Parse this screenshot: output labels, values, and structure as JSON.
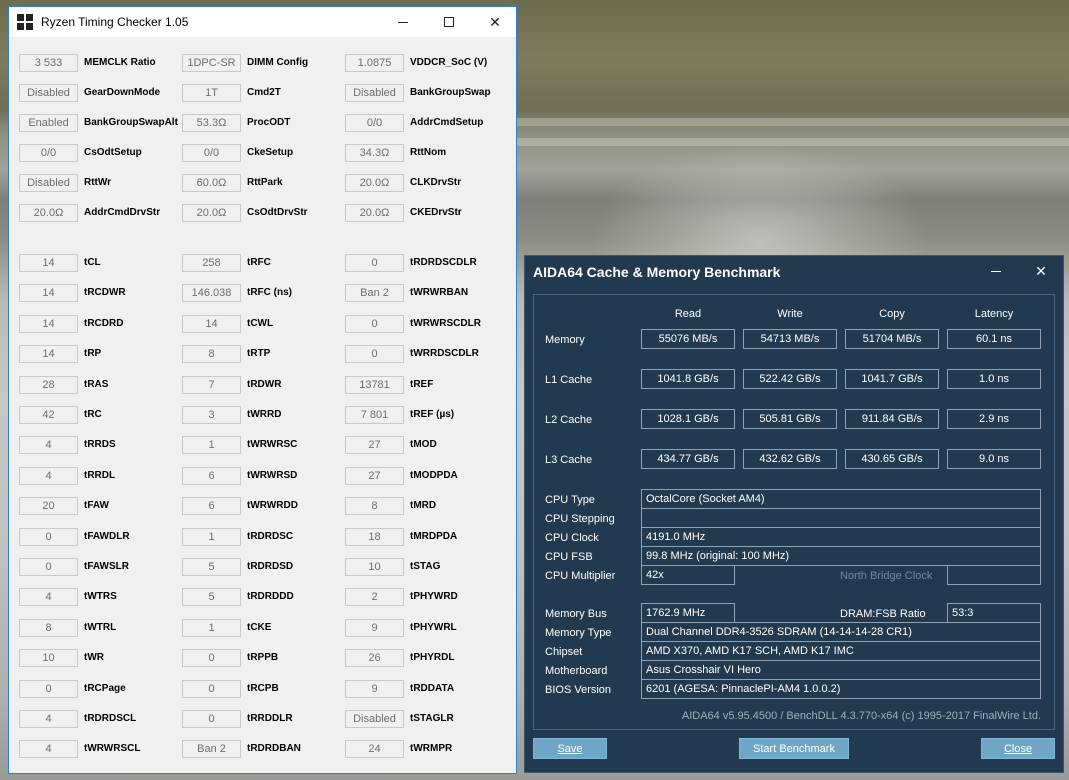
{
  "rtc": {
    "title": "Ryzen Timing Checker 1.05",
    "rows": [
      [
        {
          "v": "3 533",
          "l": "MEMCLK Ratio"
        },
        {
          "v": "1DPC-SR",
          "l": "DIMM Config"
        },
        {
          "v": "1.0875",
          "l": "VDDCR_SoC (V)"
        }
      ],
      [
        {
          "v": "Disabled",
          "l": "GearDownMode"
        },
        {
          "v": "1T",
          "l": "Cmd2T"
        },
        {
          "v": "Disabled",
          "l": "BankGroupSwap"
        }
      ],
      [
        {
          "v": "Enabled",
          "l": "BankGroupSwapAlt"
        },
        {
          "v": "53.3Ω",
          "l": "ProcODT"
        },
        {
          "v": "0/0",
          "l": "AddrCmdSetup"
        }
      ],
      [
        {
          "v": "0/0",
          "l": "CsOdtSetup"
        },
        {
          "v": "0/0",
          "l": "CkeSetup"
        },
        {
          "v": "34.3Ω",
          "l": "RttNom"
        }
      ],
      [
        {
          "v": "Disabled",
          "l": "RttWr"
        },
        {
          "v": "60.0Ω",
          "l": "RttPark"
        },
        {
          "v": "20.0Ω",
          "l": "CLKDrvStr"
        }
      ],
      [
        {
          "v": "20.0Ω",
          "l": "AddrCmdDrvStr"
        },
        {
          "v": "20.0Ω",
          "l": "CsOdtDrvStr"
        },
        {
          "v": "20.0Ω",
          "l": "CKEDrvStr"
        }
      ],
      [
        {
          "v": "14",
          "l": "tCL"
        },
        {
          "v": "258",
          "l": "tRFC"
        },
        {
          "v": "0",
          "l": "tRDRDSCDLR"
        }
      ],
      [
        {
          "v": "14",
          "l": "tRCDWR"
        },
        {
          "v": "146.038",
          "l": "tRFC (ns)"
        },
        {
          "v": "Ban 2",
          "l": "tWRWRBAN"
        }
      ],
      [
        {
          "v": "14",
          "l": "tRCDRD"
        },
        {
          "v": "14",
          "l": "tCWL"
        },
        {
          "v": "0",
          "l": "tWRWRSCDLR"
        }
      ],
      [
        {
          "v": "14",
          "l": "tRP"
        },
        {
          "v": "8",
          "l": "tRTP"
        },
        {
          "v": "0",
          "l": "tWRRDSCDLR"
        }
      ],
      [
        {
          "v": "28",
          "l": "tRAS"
        },
        {
          "v": "7",
          "l": "tRDWR"
        },
        {
          "v": "13781",
          "l": "tREF"
        }
      ],
      [
        {
          "v": "42",
          "l": "tRC"
        },
        {
          "v": "3",
          "l": "tWRRD"
        },
        {
          "v": "7 801",
          "l": "tREF (µs)"
        }
      ],
      [
        {
          "v": "4",
          "l": "tRRDS"
        },
        {
          "v": "1",
          "l": "tWRWRSC"
        },
        {
          "v": "27",
          "l": "tMOD"
        }
      ],
      [
        {
          "v": "4",
          "l": "tRRDL"
        },
        {
          "v": "6",
          "l": "tWRWRSD"
        },
        {
          "v": "27",
          "l": "tMODPDA"
        }
      ],
      [
        {
          "v": "20",
          "l": "tFAW"
        },
        {
          "v": "6",
          "l": "tWRWRDD"
        },
        {
          "v": "8",
          "l": "tMRD"
        }
      ],
      [
        {
          "v": "0",
          "l": "tFAWDLR"
        },
        {
          "v": "1",
          "l": "tRDRDSC"
        },
        {
          "v": "18",
          "l": "tMRDPDA"
        }
      ],
      [
        {
          "v": "0",
          "l": "tFAWSLR"
        },
        {
          "v": "5",
          "l": "tRDRDSD"
        },
        {
          "v": "10",
          "l": "tSTAG"
        }
      ],
      [
        {
          "v": "4",
          "l": "tWTRS"
        },
        {
          "v": "5",
          "l": "tRDRDDD"
        },
        {
          "v": "2",
          "l": "tPHYWRD"
        }
      ],
      [
        {
          "v": "8",
          "l": "tWTRL"
        },
        {
          "v": "1",
          "l": "tCKE"
        },
        {
          "v": "9",
          "l": "tPHYWRL"
        }
      ],
      [
        {
          "v": "10",
          "l": "tWR"
        },
        {
          "v": "0",
          "l": "tRPPB"
        },
        {
          "v": "26",
          "l": "tPHYRDL"
        }
      ],
      [
        {
          "v": "0",
          "l": "tRCPage"
        },
        {
          "v": "0",
          "l": "tRCPB"
        },
        {
          "v": "9",
          "l": "tRDDATA"
        }
      ],
      [
        {
          "v": "4",
          "l": "tRDRDSCL"
        },
        {
          "v": "0",
          "l": "tRRDDLR"
        },
        {
          "v": "Disabled",
          "l": "tSTAGLR"
        }
      ],
      [
        {
          "v": "4",
          "l": "tWRWRSCL"
        },
        {
          "v": "Ban 2",
          "l": "tRDRDBAN"
        },
        {
          "v": "24",
          "l": "tWRMPR"
        }
      ]
    ]
  },
  "aida": {
    "title": "AIDA64 Cache & Memory Benchmark",
    "columns": [
      "Read",
      "Write",
      "Copy",
      "Latency"
    ],
    "bench_rows": [
      {
        "label": "Memory",
        "values": [
          "55076 MB/s",
          "54713 MB/s",
          "51704 MB/s",
          "60.1 ns"
        ]
      },
      {
        "label": "L1 Cache",
        "values": [
          "1041.8 GB/s",
          "522.42 GB/s",
          "1041.7 GB/s",
          "1.0 ns"
        ]
      },
      {
        "label": "L2 Cache",
        "values": [
          "1028.1 GB/s",
          "505.81 GB/s",
          "911.84 GB/s",
          "2.9 ns"
        ]
      },
      {
        "label": "L3 Cache",
        "values": [
          "434.77 GB/s",
          "432.62 GB/s",
          "430.65 GB/s",
          "9.0 ns"
        ]
      }
    ],
    "cpu": {
      "type_label": "CPU Type",
      "type": "OctalCore   (Socket AM4)",
      "stepping_label": "CPU Stepping",
      "stepping": "",
      "clock_label": "CPU Clock",
      "clock": "4191.0 MHz",
      "fsb_label": "CPU FSB",
      "fsb": "99.8 MHz  (original: 100 MHz)",
      "mult_label": "CPU Multiplier",
      "mult": "42x",
      "nb_label": "North Bridge Clock",
      "nb": ""
    },
    "mem": {
      "bus_label": "Memory Bus",
      "bus": "1762.9 MHz",
      "ratio_label": "DRAM:FSB Ratio",
      "ratio": "53:3",
      "type_label": "Memory Type",
      "type": "Dual Channel DDR4-3526 SDRAM  (14-14-14-28 CR1)",
      "chipset_label": "Chipset",
      "chipset": "AMD X370, AMD K17 SCH, AMD K17 IMC",
      "mb_label": "Motherboard",
      "mb": "Asus Crosshair VI Hero",
      "bios_label": "BIOS Version",
      "bios": "6201  (AGESA: PinnaclePI-AM4 1.0.0.2)"
    },
    "footer": "AIDA64 v5.95.4500 / BenchDLL 4.3.770-x64  (c) 1995-2017 FinalWire Ltd.",
    "buttons": {
      "save_label": "Save",
      "start_label": "Start Benchmark",
      "close_label": "Close"
    }
  }
}
